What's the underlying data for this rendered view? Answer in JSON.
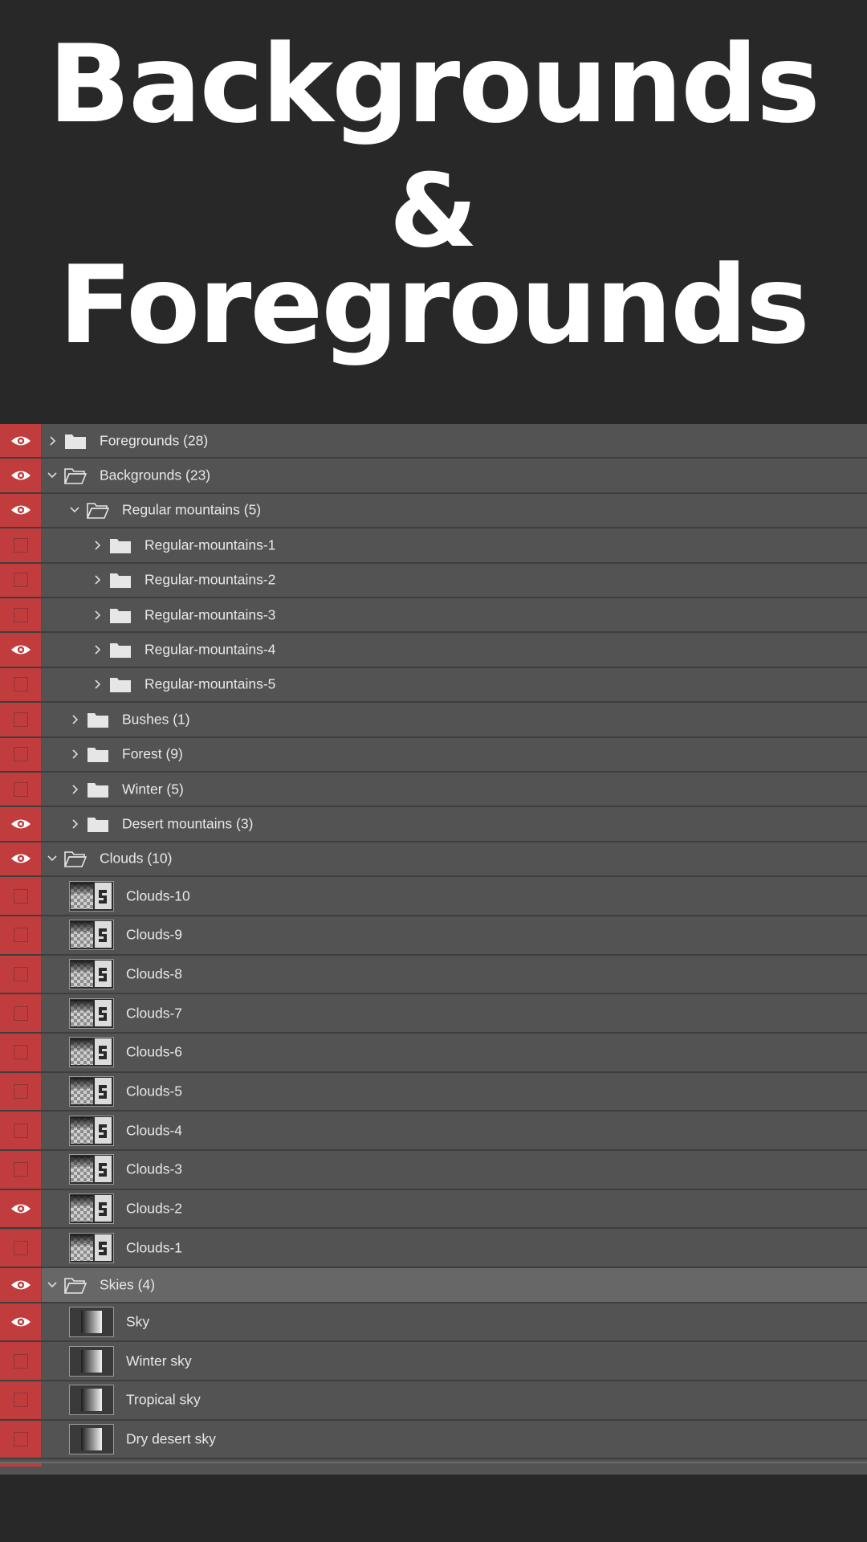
{
  "title": {
    "line1": "Backgrounds",
    "line2": "&",
    "line3": "Foregrounds"
  },
  "colors": {
    "background": "#282828",
    "panel": "#535353",
    "panel_selected": "#676767",
    "visibility_column": "#c13d3d",
    "text": "#e8e8e8"
  },
  "layers": [
    {
      "label": "Foregrounds (28)",
      "kind": "group",
      "indent": 0,
      "expanded": false,
      "visible": true
    },
    {
      "label": "Backgrounds (23)",
      "kind": "group",
      "indent": 0,
      "expanded": true,
      "visible": true
    },
    {
      "label": "Regular mountains (5)",
      "kind": "group",
      "indent": 1,
      "expanded": true,
      "visible": true
    },
    {
      "label": "Regular-mountains-1",
      "kind": "group",
      "indent": 2,
      "expanded": false,
      "visible": false
    },
    {
      "label": "Regular-mountains-2",
      "kind": "group",
      "indent": 2,
      "expanded": false,
      "visible": false
    },
    {
      "label": "Regular-mountains-3",
      "kind": "group",
      "indent": 2,
      "expanded": false,
      "visible": false
    },
    {
      "label": "Regular-mountains-4",
      "kind": "group",
      "indent": 2,
      "expanded": false,
      "visible": true
    },
    {
      "label": "Regular-mountains-5",
      "kind": "group",
      "indent": 2,
      "expanded": false,
      "visible": false
    },
    {
      "label": "Bushes (1)",
      "kind": "group",
      "indent": 1,
      "expanded": false,
      "visible": false
    },
    {
      "label": "Forest (9)",
      "kind": "group",
      "indent": 1,
      "expanded": false,
      "visible": false
    },
    {
      "label": "Winter (5)",
      "kind": "group",
      "indent": 1,
      "expanded": false,
      "visible": false
    },
    {
      "label": "Desert mountains (3)",
      "kind": "group",
      "indent": 1,
      "expanded": false,
      "visible": true
    },
    {
      "label": "Clouds (10)",
      "kind": "group",
      "indent": 0,
      "expanded": true,
      "visible": true
    },
    {
      "label": "Clouds-10",
      "kind": "cloud",
      "visible": false
    },
    {
      "label": "Clouds-9",
      "kind": "cloud",
      "visible": false
    },
    {
      "label": "Clouds-8",
      "kind": "cloud",
      "visible": false
    },
    {
      "label": "Clouds-7",
      "kind": "cloud",
      "visible": false
    },
    {
      "label": "Clouds-6",
      "kind": "cloud",
      "visible": false
    },
    {
      "label": "Clouds-5",
      "kind": "cloud",
      "visible": false
    },
    {
      "label": "Clouds-4",
      "kind": "cloud",
      "visible": false
    },
    {
      "label": "Clouds-3",
      "kind": "cloud",
      "visible": false
    },
    {
      "label": "Clouds-2",
      "kind": "cloud",
      "visible": true
    },
    {
      "label": "Clouds-1",
      "kind": "cloud",
      "visible": false
    },
    {
      "label": "Skies (4)",
      "kind": "group",
      "indent": 0,
      "expanded": true,
      "visible": true,
      "selected": true
    },
    {
      "label": "Sky",
      "kind": "sky",
      "visible": true
    },
    {
      "label": "Winter sky",
      "kind": "sky",
      "visible": false
    },
    {
      "label": "Tropical sky",
      "kind": "sky",
      "visible": false
    },
    {
      "label": "Dry desert sky",
      "kind": "sky",
      "visible": false
    }
  ]
}
